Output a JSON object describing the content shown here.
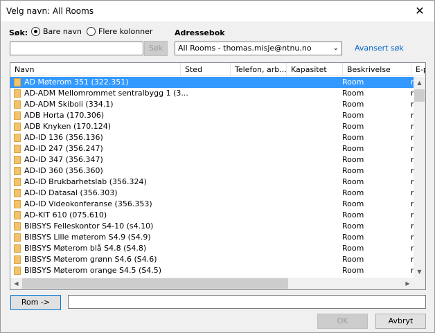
{
  "window": {
    "title": "Velg navn: All Rooms",
    "close_glyph": "✕"
  },
  "search": {
    "label": "Søk:",
    "option_name_only": "Bare navn",
    "option_more_columns": "Flere kolonner",
    "selected_option": "Bare navn",
    "input_value": "",
    "button": "Søk"
  },
  "addressbook": {
    "label": "Adressebok",
    "selected": "All Rooms - thomas.misje@ntnu.no",
    "advanced_link": "Avansert søk"
  },
  "columns": [
    "Navn",
    "Sted",
    "Telefon, arb...",
    "Kapasitet",
    "Beskrivelse",
    "E-p"
  ],
  "rows": [
    {
      "name": "AD Møterom 351 (322.351)",
      "description": "Room",
      "email": "r",
      "selected": true
    },
    {
      "name": "AD-ADM Mellomrommet sentralbygg 1 (3...",
      "description": "Room",
      "email": "r"
    },
    {
      "name": "AD-ADM Skiboli (334.1)",
      "description": "Room",
      "email": "r"
    },
    {
      "name": "ADB Horta (170.306)",
      "description": "Room",
      "email": "r"
    },
    {
      "name": "ADB Knyken (170.124)",
      "description": "Room",
      "email": "r"
    },
    {
      "name": "AD-ID 136 (356.136)",
      "description": "Room",
      "email": "r"
    },
    {
      "name": "AD-ID 247 (356.247)",
      "description": "Room",
      "email": "r"
    },
    {
      "name": "AD-ID 347 (356.347)",
      "description": "Room",
      "email": "r"
    },
    {
      "name": "AD-ID 360 (356.360)",
      "description": "Room",
      "email": "r"
    },
    {
      "name": "AD-ID Brukbarhetslab (356.324)",
      "description": "Room",
      "email": "r"
    },
    {
      "name": "AD-ID Datasal (356.303)",
      "description": "Room",
      "email": "r"
    },
    {
      "name": "AD-ID Videokonferanse (356.353)",
      "description": "Room",
      "email": "r"
    },
    {
      "name": "AD-KIT 610 (075.610)",
      "description": "Room",
      "email": "r"
    },
    {
      "name": "BIBSYS Felleskontor S4-10 (s4.10)",
      "description": "Room",
      "email": "r"
    },
    {
      "name": "BIBSYS Lille møterom S4.9 (S4.9)",
      "description": "Room",
      "email": "r"
    },
    {
      "name": "BIBSYS Møterom blå S4.8 (S4.8)",
      "description": "Room",
      "email": "r"
    },
    {
      "name": "BIBSYS Møterom grønn S4.6 (S4.6)",
      "description": "Room",
      "email": "r"
    },
    {
      "name": "BIBSYS Møterom orange S4.5 (S4.5)",
      "description": "Room",
      "email": "r"
    }
  ],
  "bottom": {
    "rom_button": "Rom ->",
    "rom_value": "",
    "ok_button": "OK",
    "cancel_button": "Avbryt"
  }
}
